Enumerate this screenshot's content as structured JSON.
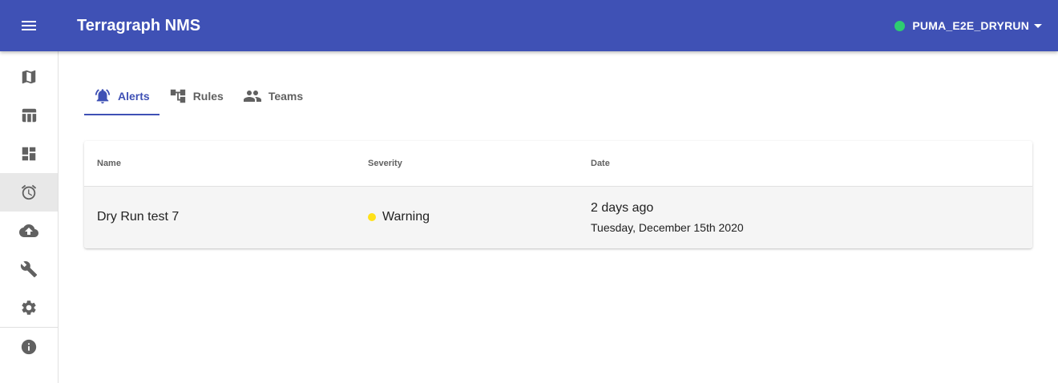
{
  "app": {
    "title": "Terragraph NMS",
    "network_name": "PUMA_E2E_DRYRUN",
    "network_status_color": "#2ecc71",
    "header_color": "#3f51b5"
  },
  "sidebar": {
    "items": [
      {
        "icon": "map-icon"
      },
      {
        "icon": "table-icon"
      },
      {
        "icon": "dashboard-icon"
      },
      {
        "icon": "alarm-clock-icon",
        "active": true
      },
      {
        "icon": "cloud-upload-icon"
      },
      {
        "icon": "wrench-icon"
      },
      {
        "icon": "gear-icon"
      },
      {
        "icon": "info-icon"
      }
    ]
  },
  "tabs": [
    {
      "label": "Alerts",
      "icon": "bell-icon",
      "active": true
    },
    {
      "label": "Rules",
      "icon": "hierarchy-icon",
      "active": false
    },
    {
      "label": "Teams",
      "icon": "people-icon",
      "active": false
    }
  ],
  "table": {
    "headers": {
      "name": "Name",
      "severity": "Severity",
      "date": "Date"
    },
    "rows": [
      {
        "name": "Dry Run test 7",
        "severity": "Warning",
        "severity_color": "#ffe119",
        "date_relative": "2 days ago",
        "date_full": "Tuesday, December 15th 2020"
      }
    ]
  }
}
